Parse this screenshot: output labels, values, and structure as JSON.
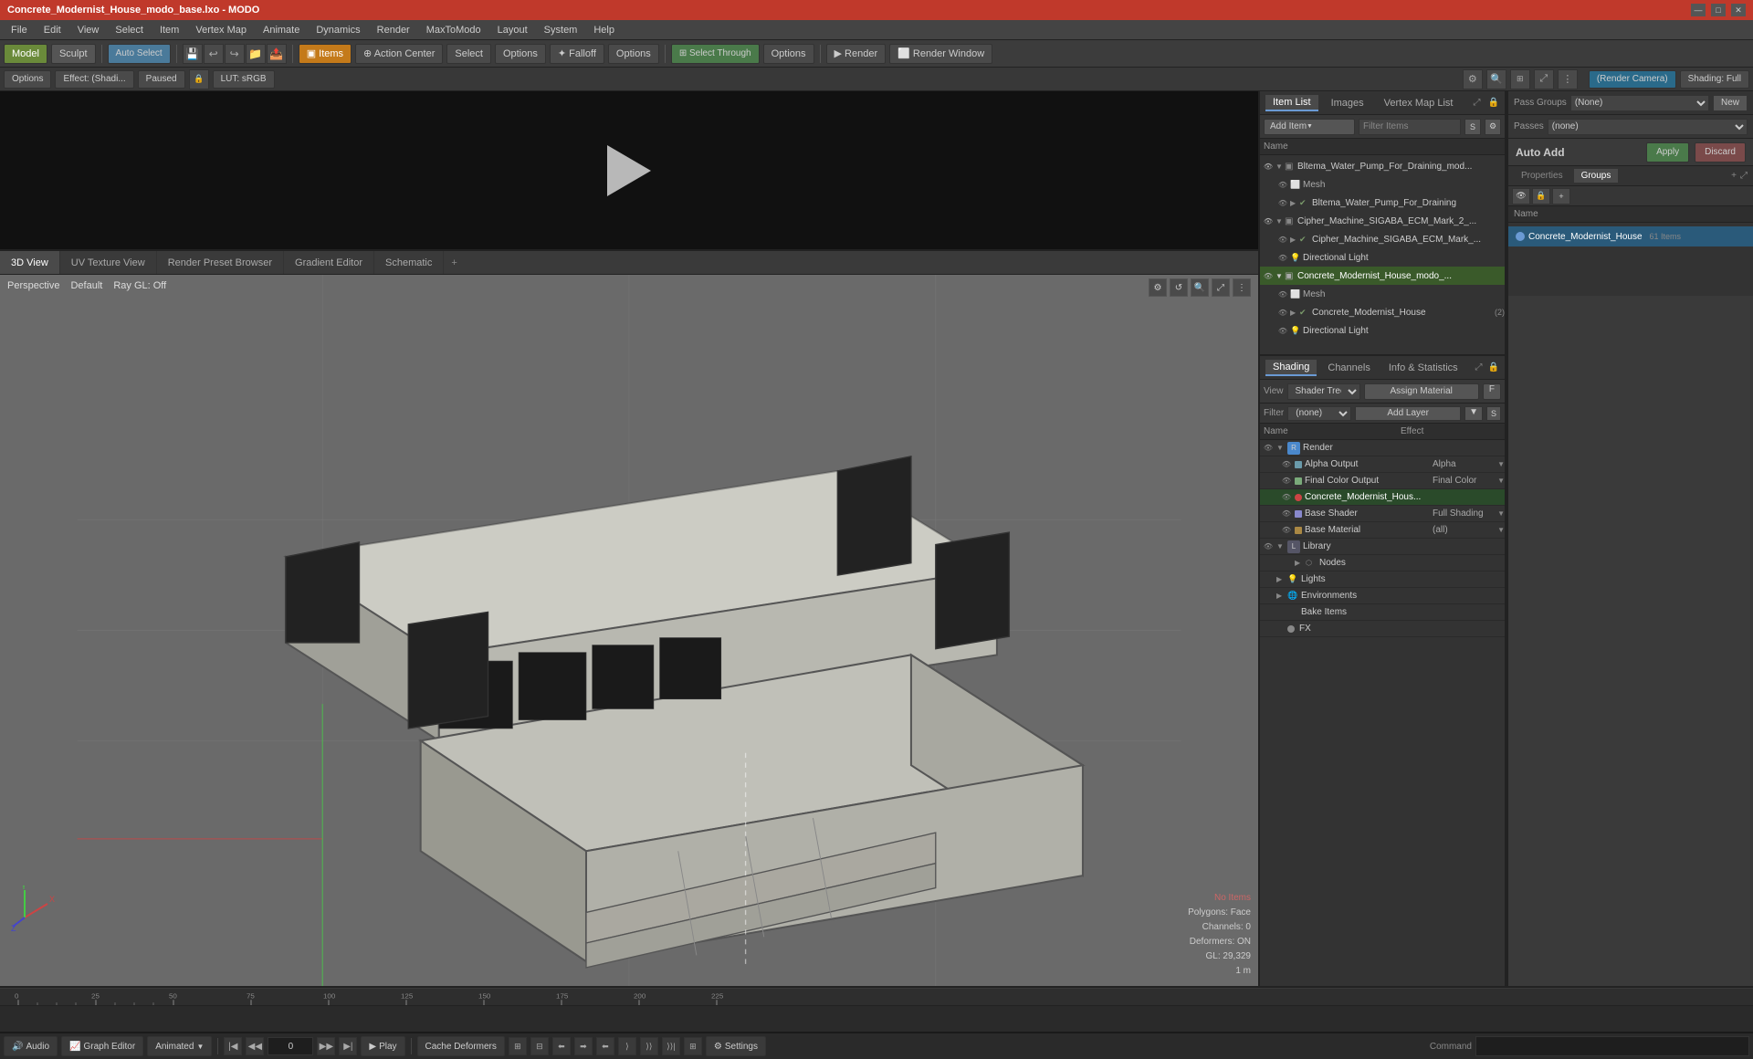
{
  "titlebar": {
    "title": "Concrete_Modernist_House_modo_base.lxo - MODO",
    "controls": [
      "—",
      "□",
      "✕"
    ]
  },
  "menubar": {
    "items": [
      "File",
      "Edit",
      "View",
      "Select",
      "Item",
      "Vertex Map",
      "Animate",
      "Dynamics",
      "Render",
      "MaxToModo",
      "Layout",
      "System",
      "Help"
    ]
  },
  "toolbar": {
    "mode_buttons": [
      "Model",
      "Sculpt"
    ],
    "auto_select": "Auto Select",
    "icon_buttons": [
      "save",
      "undo",
      "redo",
      "new",
      "open"
    ],
    "items_btn": "Items",
    "action_center_btn": "Action Center",
    "select_btn": "Select",
    "options_btn": "Options",
    "falloff_btn": "Falloff",
    "options2_btn": "Options",
    "select_through_btn": "Select Through",
    "options3_btn": "Options",
    "render_btn": "Render",
    "render_window_btn": "Render Window"
  },
  "secondary_toolbar": {
    "options_btn": "Options",
    "effect_btn": "Effect: (Shadi...",
    "paused_btn": "Paused",
    "lut_btn": "LUT: sRGB",
    "render_camera_btn": "(Render Camera)",
    "shading_btn": "Shading: Full"
  },
  "item_list_panel": {
    "tabs": [
      "Item List",
      "Images",
      "Vertex Map List"
    ],
    "add_item_btn": "Add Item",
    "filter_placeholder": "Filter Items",
    "col_name": "Name",
    "items": [
      {
        "name": "Bltema_Water_Pump_For_Draining_mod...",
        "indent": 0,
        "type": "group",
        "expanded": true
      },
      {
        "name": "Mesh",
        "indent": 1,
        "type": "mesh"
      },
      {
        "name": "Bltema_Water_Pump_For_Draining",
        "indent": 1,
        "type": "item",
        "expanded": false
      },
      {
        "name": "Cipher_Machine_SIGABA_ECM_Mark_2_...",
        "indent": 0,
        "type": "group",
        "expanded": true
      },
      {
        "name": "Cipher_Machine_SIGABA_ECM_Mark_...",
        "indent": 1,
        "type": "item",
        "expanded": false
      },
      {
        "name": "Directional Light",
        "indent": 1,
        "type": "light"
      },
      {
        "name": "Concrete_Modernist_House_modo_...",
        "indent": 0,
        "type": "group",
        "expanded": true,
        "selected": true
      },
      {
        "name": "Mesh",
        "indent": 1,
        "type": "mesh"
      },
      {
        "name": "Concrete_Modernist_House",
        "indent": 1,
        "type": "item",
        "count": 2
      },
      {
        "name": "Directional Light",
        "indent": 1,
        "type": "light"
      }
    ]
  },
  "shading_panel": {
    "tabs": [
      "Shading",
      "Channels",
      "Info & Statistics"
    ],
    "view_label": "View",
    "shader_tree_select": "Shader Tree",
    "assign_material_btn": "Assign Material",
    "assign_f_key": "F",
    "filter_label": "Filter",
    "filter_none": "(none)",
    "add_layer_btn": "Add Layer",
    "s_key": "S",
    "col_name": "Name",
    "col_effect": "Effect",
    "items": [
      {
        "name": "Render",
        "indent": 0,
        "type": "folder",
        "expanded": true,
        "icon": "folder"
      },
      {
        "name": "Alpha Output",
        "indent": 1,
        "type": "item",
        "effect": "Alpha",
        "vis": true
      },
      {
        "name": "Final Color Output",
        "indent": 1,
        "type": "item",
        "effect": "Final Color",
        "vis": true
      },
      {
        "name": "Concrete_Modernist_Hous...",
        "indent": 1,
        "type": "material",
        "effect": "",
        "vis": true,
        "dot": "red"
      },
      {
        "name": "Base Shader",
        "indent": 1,
        "type": "item",
        "effect": "Full Shading",
        "vis": true
      },
      {
        "name": "Base Material",
        "indent": 1,
        "type": "item",
        "effect": "(all)",
        "vis": true
      },
      {
        "name": "Library",
        "indent": 0,
        "type": "folder",
        "expanded": false
      },
      {
        "name": "Nodes",
        "indent": 1,
        "type": "item"
      },
      {
        "name": "Lights",
        "indent": 0,
        "type": "folder",
        "expanded": false
      },
      {
        "name": "Environments",
        "indent": 0,
        "type": "folder",
        "expanded": false
      },
      {
        "name": "Bake Items",
        "indent": 0,
        "type": "item"
      },
      {
        "name": "FX",
        "indent": 0,
        "type": "item",
        "dot": "gray"
      }
    ]
  },
  "group_panel": {
    "pass_groups_label": "Pass Groups",
    "pass_groups_select": "(None)",
    "new_btn": "New",
    "passes_label": "Passes",
    "passes_select": "(none)",
    "auto_add_header": "Auto Add",
    "apply_btn": "Apply",
    "discard_btn": "Discard",
    "properties_tab": "Properties",
    "groups_tab": "Groups",
    "name_col": "Name",
    "group_items": [
      {
        "name": "Concrete_Modernist_House",
        "count": "61 Items"
      }
    ]
  },
  "viewport": {
    "view_mode": "Perspective",
    "shading": "Default",
    "ray_gl": "Ray GL: Off",
    "stats": {
      "no_items": "No Items",
      "polygons": "Polygons: Face",
      "channels": "Channels: 0",
      "deformers": "Deformers: ON",
      "gl": "GL: 29,329",
      "scale": "1 m"
    }
  },
  "view_tabs": [
    {
      "label": "3D View",
      "active": true
    },
    {
      "label": "UV Texture View",
      "active": false
    },
    {
      "label": "Render Preset Browser",
      "active": false
    },
    {
      "label": "Gradient Editor",
      "active": false
    },
    {
      "label": "Schematic",
      "active": false
    },
    {
      "label": "+",
      "active": false
    }
  ],
  "timeline": {
    "markers": [
      "0",
      "25",
      "50",
      "75",
      "100",
      "125",
      "150",
      "175",
      "200",
      "225"
    ],
    "current_frame": "0",
    "end_frame": "225"
  },
  "bottom_controls": {
    "audio_btn": "Audio",
    "graph_editor_btn": "Graph Editor",
    "animated_btn": "Animated",
    "frame_input": "0",
    "play_btn": "Play",
    "cache_deformers_btn": "Cache Deformers",
    "settings_btn": "Settings",
    "command_label": "Command",
    "command_placeholder": ""
  }
}
